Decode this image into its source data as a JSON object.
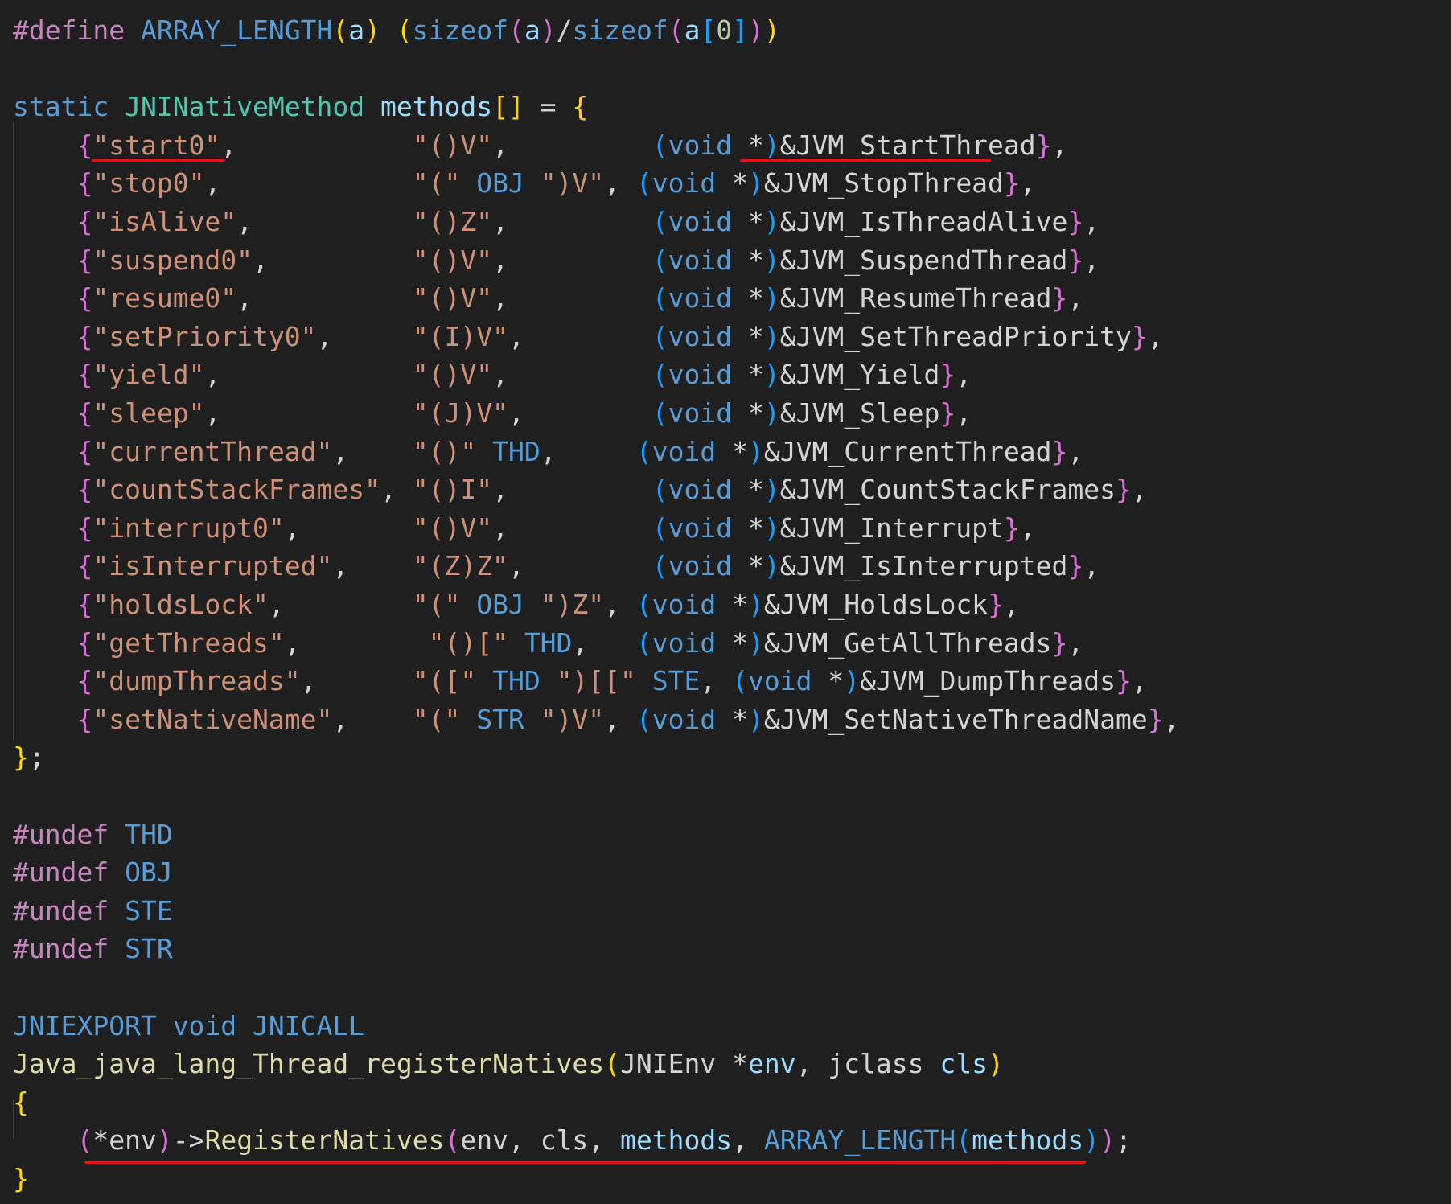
{
  "colors": {
    "background": "#1f1f1f",
    "plain": "#d4d4d4",
    "keyword_purple": "#c586c0",
    "keyword_blue": "#569cd6",
    "type": "#4ec9b0",
    "variable": "#9cdcfe",
    "function": "#dcdcaa",
    "string": "#ce9178",
    "number": "#b5cea8",
    "bracket_gold": "#ffd700",
    "bracket_orchid": "#da70d6",
    "bracket_blue": "#179fff",
    "macro": "#569cd6",
    "annotation_red": "#e0121c"
  },
  "lines": [
    [
      [
        "#define",
        "keyword_purple"
      ],
      [
        " ",
        "plain"
      ],
      [
        "ARRAY_LENGTH",
        "macro"
      ],
      [
        "(",
        "bracket_gold"
      ],
      [
        "a",
        "variable"
      ],
      [
        ")",
        "bracket_gold"
      ],
      [
        " ",
        "plain"
      ],
      [
        "(",
        "bracket_gold"
      ],
      [
        "sizeof",
        "keyword_blue"
      ],
      [
        "(",
        "bracket_orchid"
      ],
      [
        "a",
        "variable"
      ],
      [
        ")",
        "bracket_orchid"
      ],
      [
        "/",
        "plain"
      ],
      [
        "sizeof",
        "keyword_blue"
      ],
      [
        "(",
        "bracket_orchid"
      ],
      [
        "a",
        "variable"
      ],
      [
        "[",
        "bracket_blue"
      ],
      [
        "0",
        "number"
      ],
      [
        "]",
        "bracket_blue"
      ],
      [
        ")",
        "bracket_orchid"
      ],
      [
        ")",
        "bracket_gold"
      ]
    ],
    [],
    [
      [
        "static",
        "keyword_blue"
      ],
      [
        " ",
        "plain"
      ],
      [
        "JNINativeMethod",
        "type"
      ],
      [
        " ",
        "plain"
      ],
      [
        "methods",
        "variable"
      ],
      [
        "[]",
        "bracket_gold"
      ],
      [
        " = ",
        "plain"
      ],
      [
        "{",
        "bracket_gold"
      ]
    ],
    [
      [
        "    ",
        "plain"
      ],
      [
        "{",
        "bracket_orchid"
      ],
      [
        "\"start0\"",
        "string"
      ],
      [
        ",           ",
        "plain"
      ],
      [
        "\"()V\"",
        "string"
      ],
      [
        ",         ",
        "plain"
      ],
      [
        "(",
        "bracket_blue"
      ],
      [
        "void",
        "keyword_blue"
      ],
      [
        " *",
        "plain"
      ],
      [
        ")",
        "bracket_blue"
      ],
      [
        "&JVM_StartThread",
        "plain"
      ],
      [
        "}",
        "bracket_orchid"
      ],
      [
        ",",
        "plain"
      ]
    ],
    [
      [
        "    ",
        "plain"
      ],
      [
        "{",
        "bracket_orchid"
      ],
      [
        "\"stop0\"",
        "string"
      ],
      [
        ",            ",
        "plain"
      ],
      [
        "\"(\"",
        "string"
      ],
      [
        " ",
        "plain"
      ],
      [
        "OBJ",
        "macro"
      ],
      [
        " ",
        "plain"
      ],
      [
        "\")V\"",
        "string"
      ],
      [
        ", ",
        "plain"
      ],
      [
        "(",
        "bracket_blue"
      ],
      [
        "void",
        "keyword_blue"
      ],
      [
        " *",
        "plain"
      ],
      [
        ")",
        "bracket_blue"
      ],
      [
        "&JVM_StopThread",
        "plain"
      ],
      [
        "}",
        "bracket_orchid"
      ],
      [
        ",",
        "plain"
      ]
    ],
    [
      [
        "    ",
        "plain"
      ],
      [
        "{",
        "bracket_orchid"
      ],
      [
        "\"isAlive\"",
        "string"
      ],
      [
        ",          ",
        "plain"
      ],
      [
        "\"()Z\"",
        "string"
      ],
      [
        ",         ",
        "plain"
      ],
      [
        "(",
        "bracket_blue"
      ],
      [
        "void",
        "keyword_blue"
      ],
      [
        " *",
        "plain"
      ],
      [
        ")",
        "bracket_blue"
      ],
      [
        "&JVM_IsThreadAlive",
        "plain"
      ],
      [
        "}",
        "bracket_orchid"
      ],
      [
        ",",
        "plain"
      ]
    ],
    [
      [
        "    ",
        "plain"
      ],
      [
        "{",
        "bracket_orchid"
      ],
      [
        "\"suspend0\"",
        "string"
      ],
      [
        ",         ",
        "plain"
      ],
      [
        "\"()V\"",
        "string"
      ],
      [
        ",         ",
        "plain"
      ],
      [
        "(",
        "bracket_blue"
      ],
      [
        "void",
        "keyword_blue"
      ],
      [
        " *",
        "plain"
      ],
      [
        ")",
        "bracket_blue"
      ],
      [
        "&JVM_SuspendThread",
        "plain"
      ],
      [
        "}",
        "bracket_orchid"
      ],
      [
        ",",
        "plain"
      ]
    ],
    [
      [
        "    ",
        "plain"
      ],
      [
        "{",
        "bracket_orchid"
      ],
      [
        "\"resume0\"",
        "string"
      ],
      [
        ",          ",
        "plain"
      ],
      [
        "\"()V\"",
        "string"
      ],
      [
        ",         ",
        "plain"
      ],
      [
        "(",
        "bracket_blue"
      ],
      [
        "void",
        "keyword_blue"
      ],
      [
        " *",
        "plain"
      ],
      [
        ")",
        "bracket_blue"
      ],
      [
        "&JVM_ResumeThread",
        "plain"
      ],
      [
        "}",
        "bracket_orchid"
      ],
      [
        ",",
        "plain"
      ]
    ],
    [
      [
        "    ",
        "plain"
      ],
      [
        "{",
        "bracket_orchid"
      ],
      [
        "\"setPriority0\"",
        "string"
      ],
      [
        ",     ",
        "plain"
      ],
      [
        "\"(I)V\"",
        "string"
      ],
      [
        ",        ",
        "plain"
      ],
      [
        "(",
        "bracket_blue"
      ],
      [
        "void",
        "keyword_blue"
      ],
      [
        " *",
        "plain"
      ],
      [
        ")",
        "bracket_blue"
      ],
      [
        "&JVM_SetThreadPriority",
        "plain"
      ],
      [
        "}",
        "bracket_orchid"
      ],
      [
        ",",
        "plain"
      ]
    ],
    [
      [
        "    ",
        "plain"
      ],
      [
        "{",
        "bracket_orchid"
      ],
      [
        "\"yield\"",
        "string"
      ],
      [
        ",            ",
        "plain"
      ],
      [
        "\"()V\"",
        "string"
      ],
      [
        ",         ",
        "plain"
      ],
      [
        "(",
        "bracket_blue"
      ],
      [
        "void",
        "keyword_blue"
      ],
      [
        " *",
        "plain"
      ],
      [
        ")",
        "bracket_blue"
      ],
      [
        "&JVM_Yield",
        "plain"
      ],
      [
        "}",
        "bracket_orchid"
      ],
      [
        ",",
        "plain"
      ]
    ],
    [
      [
        "    ",
        "plain"
      ],
      [
        "{",
        "bracket_orchid"
      ],
      [
        "\"sleep\"",
        "string"
      ],
      [
        ",            ",
        "plain"
      ],
      [
        "\"(J)V\"",
        "string"
      ],
      [
        ",        ",
        "plain"
      ],
      [
        "(",
        "bracket_blue"
      ],
      [
        "void",
        "keyword_blue"
      ],
      [
        " *",
        "plain"
      ],
      [
        ")",
        "bracket_blue"
      ],
      [
        "&JVM_Sleep",
        "plain"
      ],
      [
        "}",
        "bracket_orchid"
      ],
      [
        ",",
        "plain"
      ]
    ],
    [
      [
        "    ",
        "plain"
      ],
      [
        "{",
        "bracket_orchid"
      ],
      [
        "\"currentThread\"",
        "string"
      ],
      [
        ",    ",
        "plain"
      ],
      [
        "\"()\"",
        "string"
      ],
      [
        " ",
        "plain"
      ],
      [
        "THD",
        "macro"
      ],
      [
        ",     ",
        "plain"
      ],
      [
        "(",
        "bracket_blue"
      ],
      [
        "void",
        "keyword_blue"
      ],
      [
        " *",
        "plain"
      ],
      [
        ")",
        "bracket_blue"
      ],
      [
        "&JVM_CurrentThread",
        "plain"
      ],
      [
        "}",
        "bracket_orchid"
      ],
      [
        ",",
        "plain"
      ]
    ],
    [
      [
        "    ",
        "plain"
      ],
      [
        "{",
        "bracket_orchid"
      ],
      [
        "\"countStackFrames\"",
        "string"
      ],
      [
        ", ",
        "plain"
      ],
      [
        "\"()I\"",
        "string"
      ],
      [
        ",         ",
        "plain"
      ],
      [
        "(",
        "bracket_blue"
      ],
      [
        "void",
        "keyword_blue"
      ],
      [
        " *",
        "plain"
      ],
      [
        ")",
        "bracket_blue"
      ],
      [
        "&JVM_CountStackFrames",
        "plain"
      ],
      [
        "}",
        "bracket_orchid"
      ],
      [
        ",",
        "plain"
      ]
    ],
    [
      [
        "    ",
        "plain"
      ],
      [
        "{",
        "bracket_orchid"
      ],
      [
        "\"interrupt0\"",
        "string"
      ],
      [
        ",       ",
        "plain"
      ],
      [
        "\"()V\"",
        "string"
      ],
      [
        ",         ",
        "plain"
      ],
      [
        "(",
        "bracket_blue"
      ],
      [
        "void",
        "keyword_blue"
      ],
      [
        " *",
        "plain"
      ],
      [
        ")",
        "bracket_blue"
      ],
      [
        "&JVM_Interrupt",
        "plain"
      ],
      [
        "}",
        "bracket_orchid"
      ],
      [
        ",",
        "plain"
      ]
    ],
    [
      [
        "    ",
        "plain"
      ],
      [
        "{",
        "bracket_orchid"
      ],
      [
        "\"isInterrupted\"",
        "string"
      ],
      [
        ",    ",
        "plain"
      ],
      [
        "\"(Z)Z\"",
        "string"
      ],
      [
        ",        ",
        "plain"
      ],
      [
        "(",
        "bracket_blue"
      ],
      [
        "void",
        "keyword_blue"
      ],
      [
        " *",
        "plain"
      ],
      [
        ")",
        "bracket_blue"
      ],
      [
        "&JVM_IsInterrupted",
        "plain"
      ],
      [
        "}",
        "bracket_orchid"
      ],
      [
        ",",
        "plain"
      ]
    ],
    [
      [
        "    ",
        "plain"
      ],
      [
        "{",
        "bracket_orchid"
      ],
      [
        "\"holdsLock\"",
        "string"
      ],
      [
        ",        ",
        "plain"
      ],
      [
        "\"(\"",
        "string"
      ],
      [
        " ",
        "plain"
      ],
      [
        "OBJ",
        "macro"
      ],
      [
        " ",
        "plain"
      ],
      [
        "\")Z\"",
        "string"
      ],
      [
        ", ",
        "plain"
      ],
      [
        "(",
        "bracket_blue"
      ],
      [
        "void",
        "keyword_blue"
      ],
      [
        " *",
        "plain"
      ],
      [
        ")",
        "bracket_blue"
      ],
      [
        "&JVM_HoldsLock",
        "plain"
      ],
      [
        "}",
        "bracket_orchid"
      ],
      [
        ",",
        "plain"
      ]
    ],
    [
      [
        "    ",
        "plain"
      ],
      [
        "{",
        "bracket_orchid"
      ],
      [
        "\"getThreads\"",
        "string"
      ],
      [
        ",        ",
        "plain"
      ],
      [
        "\"()[\"",
        "string"
      ],
      [
        " ",
        "plain"
      ],
      [
        "THD",
        "macro"
      ],
      [
        ",   ",
        "plain"
      ],
      [
        "(",
        "bracket_blue"
      ],
      [
        "void",
        "keyword_blue"
      ],
      [
        " *",
        "plain"
      ],
      [
        ")",
        "bracket_blue"
      ],
      [
        "&JVM_GetAllThreads",
        "plain"
      ],
      [
        "}",
        "bracket_orchid"
      ],
      [
        ",",
        "plain"
      ]
    ],
    [
      [
        "    ",
        "plain"
      ],
      [
        "{",
        "bracket_orchid"
      ],
      [
        "\"dumpThreads\"",
        "string"
      ],
      [
        ",      ",
        "plain"
      ],
      [
        "\"([\"",
        "string"
      ],
      [
        " ",
        "plain"
      ],
      [
        "THD",
        "macro"
      ],
      [
        " ",
        "plain"
      ],
      [
        "\")[[\"",
        "string"
      ],
      [
        " ",
        "plain"
      ],
      [
        "STE",
        "macro"
      ],
      [
        ", ",
        "plain"
      ],
      [
        "(",
        "bracket_blue"
      ],
      [
        "void",
        "keyword_blue"
      ],
      [
        " *",
        "plain"
      ],
      [
        ")",
        "bracket_blue"
      ],
      [
        "&JVM_DumpThreads",
        "plain"
      ],
      [
        "}",
        "bracket_orchid"
      ],
      [
        ",",
        "plain"
      ]
    ],
    [
      [
        "    ",
        "plain"
      ],
      [
        "{",
        "bracket_orchid"
      ],
      [
        "\"setNativeName\"",
        "string"
      ],
      [
        ",    ",
        "plain"
      ],
      [
        "\"(\"",
        "string"
      ],
      [
        " ",
        "plain"
      ],
      [
        "STR",
        "macro"
      ],
      [
        " ",
        "plain"
      ],
      [
        "\")V\"",
        "string"
      ],
      [
        ", ",
        "plain"
      ],
      [
        "(",
        "bracket_blue"
      ],
      [
        "void",
        "keyword_blue"
      ],
      [
        " *",
        "plain"
      ],
      [
        ")",
        "bracket_blue"
      ],
      [
        "&JVM_SetNativeThreadName",
        "plain"
      ],
      [
        "}",
        "bracket_orchid"
      ],
      [
        ",",
        "plain"
      ]
    ],
    [
      [
        "}",
        "bracket_gold"
      ],
      [
        ";",
        "plain"
      ]
    ],
    [],
    [
      [
        "#undef",
        "keyword_purple"
      ],
      [
        " ",
        "plain"
      ],
      [
        "THD",
        "macro"
      ]
    ],
    [
      [
        "#undef",
        "keyword_purple"
      ],
      [
        " ",
        "plain"
      ],
      [
        "OBJ",
        "macro"
      ]
    ],
    [
      [
        "#undef",
        "keyword_purple"
      ],
      [
        " ",
        "plain"
      ],
      [
        "STE",
        "macro"
      ]
    ],
    [
      [
        "#undef",
        "keyword_purple"
      ],
      [
        " ",
        "plain"
      ],
      [
        "STR",
        "macro"
      ]
    ],
    [],
    [
      [
        "JNIEXPORT",
        "keyword_blue"
      ],
      [
        " ",
        "plain"
      ],
      [
        "void",
        "keyword_blue"
      ],
      [
        " ",
        "plain"
      ],
      [
        "JNICALL",
        "keyword_blue"
      ]
    ],
    [
      [
        "Java_java_lang_Thread_registerNatives",
        "function"
      ],
      [
        "(",
        "bracket_gold"
      ],
      [
        "JNIEnv",
        "plain"
      ],
      [
        " *",
        "plain"
      ],
      [
        "env",
        "variable"
      ],
      [
        ", jclass ",
        "plain"
      ],
      [
        "cls",
        "variable"
      ],
      [
        ")",
        "bracket_gold"
      ]
    ],
    [
      [
        "{",
        "bracket_gold"
      ]
    ],
    [
      [
        "    ",
        "plain"
      ],
      [
        "(",
        "bracket_orchid"
      ],
      [
        "*env",
        "plain"
      ],
      [
        ")",
        "bracket_orchid"
      ],
      [
        "->",
        "plain"
      ],
      [
        "RegisterNatives",
        "function"
      ],
      [
        "(",
        "bracket_orchid"
      ],
      [
        "env, cls, ",
        "plain"
      ],
      [
        "methods",
        "variable"
      ],
      [
        ", ",
        "plain"
      ],
      [
        "ARRAY_LENGTH",
        "macro"
      ],
      [
        "(",
        "bracket_blue"
      ],
      [
        "methods",
        "variable"
      ],
      [
        ")",
        "bracket_blue"
      ],
      [
        ")",
        "bracket_orchid"
      ],
      [
        ";",
        "plain"
      ]
    ],
    [
      [
        "}",
        "bracket_gold"
      ]
    ]
  ]
}
